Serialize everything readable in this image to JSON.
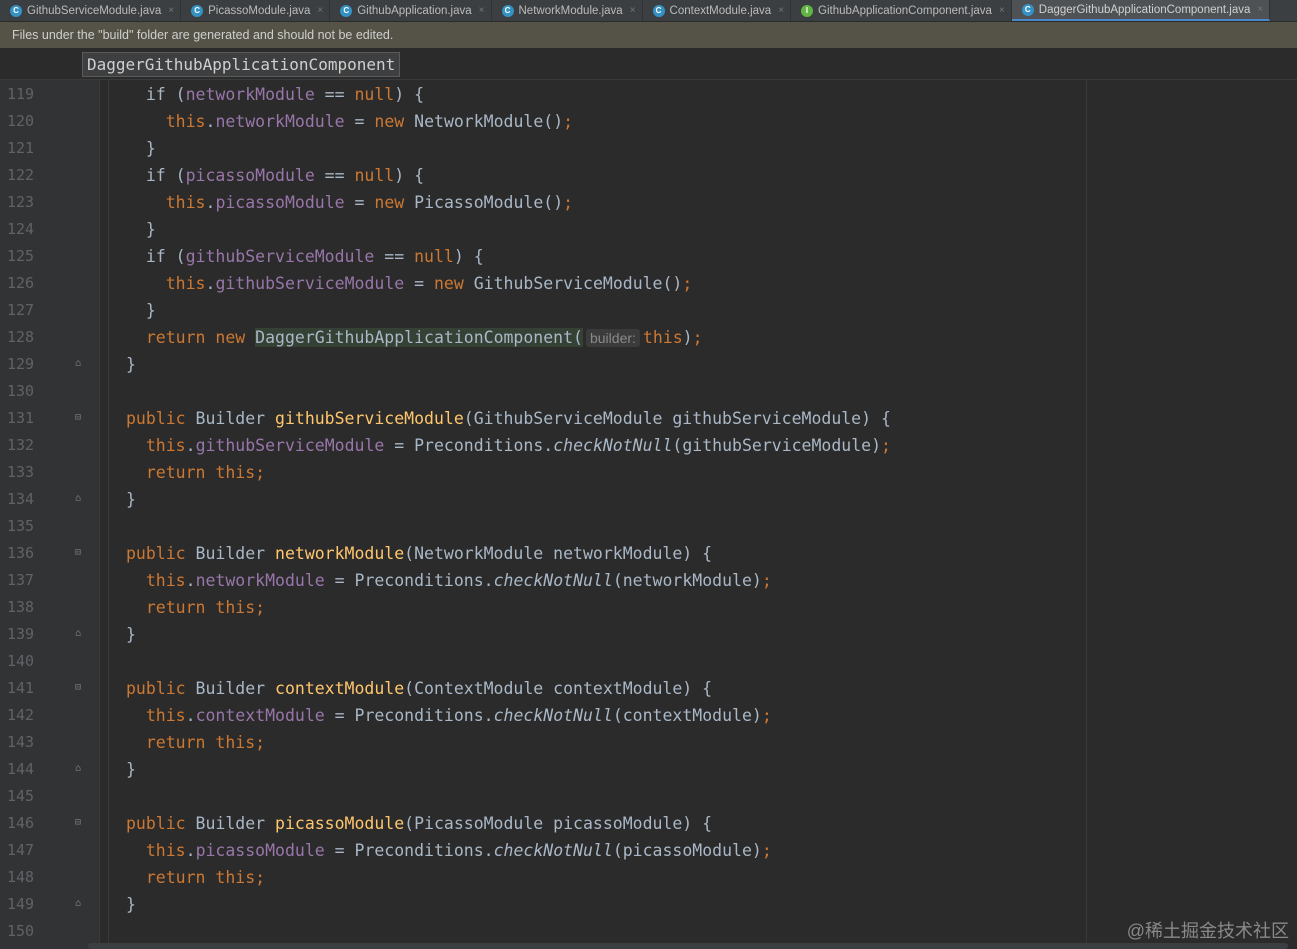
{
  "tabs": [
    {
      "label": "GithubServiceModule.java",
      "icon": "C",
      "color": "blue"
    },
    {
      "label": "PicassoModule.java",
      "icon": "C",
      "color": "blue"
    },
    {
      "label": "GithubApplication.java",
      "icon": "C",
      "color": "blue"
    },
    {
      "label": "NetworkModule.java",
      "icon": "C",
      "color": "blue"
    },
    {
      "label": "ContextModule.java",
      "icon": "C",
      "color": "blue"
    },
    {
      "label": "GithubApplicationComponent.java",
      "icon": "I",
      "color": "green"
    },
    {
      "label": "DaggerGithubApplicationComponent.java",
      "icon": "C",
      "color": "blue",
      "active": true
    }
  ],
  "banner": "Files under the \"build\" folder are generated and should not be edited.",
  "breadcrumb": "DaggerGithubApplicationComponent",
  "watermark": "@稀土掘金技术社区",
  "lines": [
    {
      "n": "119",
      "fold": "",
      "html": "  if (<span class='fld'>networkModule</span> == <span class='kw'>null</span>) {"
    },
    {
      "n": "120",
      "fold": "",
      "html": "    <span class='kw'>this</span>.<span class='fld'>networkModule</span> = <span class='kw'>new</span> NetworkModule()<span class='kw'>;</span>"
    },
    {
      "n": "121",
      "fold": "",
      "html": "  }"
    },
    {
      "n": "122",
      "fold": "",
      "html": "  if (<span class='fld'>picassoModule</span> == <span class='kw'>null</span>) {"
    },
    {
      "n": "123",
      "fold": "",
      "html": "    <span class='kw'>this</span>.<span class='fld'>picassoModule</span> = <span class='kw'>new</span> PicassoModule()<span class='kw'>;</span>"
    },
    {
      "n": "124",
      "fold": "",
      "html": "  }"
    },
    {
      "n": "125",
      "fold": "",
      "html": "  if (<span class='fld'>githubServiceModule</span> == <span class='kw'>null</span>) {"
    },
    {
      "n": "126",
      "fold": "",
      "html": "    <span class='kw'>this</span>.<span class='fld'>githubServiceModule</span> = <span class='kw'>new</span> GithubServiceModule()<span class='kw'>;</span>"
    },
    {
      "n": "127",
      "fold": "",
      "html": "  }"
    },
    {
      "n": "128",
      "fold": "",
      "html": "  <span class='kw'>return new</span> <span class='hl'>DaggerGithubApplicationComponent(</span><span class='hint'>builder:</span><span class='kw'>this</span>)<span class='kw'>;</span>"
    },
    {
      "n": "129",
      "fold": "end",
      "html": "}"
    },
    {
      "n": "130",
      "fold": "",
      "html": ""
    },
    {
      "n": "131",
      "fold": "start",
      "html": "<span class='kw'>public</span> Builder <span class='fn'>githubServiceModule</span>(GithubServiceModule githubServiceModule) {"
    },
    {
      "n": "132",
      "fold": "",
      "html": "  <span class='kw'>this</span>.<span class='fld'>githubServiceModule</span> = Preconditions.<span class='ital'>checkNotNull</span>(githubServiceModule)<span class='kw'>;</span>"
    },
    {
      "n": "133",
      "fold": "",
      "html": "  <span class='kw'>return this;</span>"
    },
    {
      "n": "134",
      "fold": "end",
      "html": "}"
    },
    {
      "n": "135",
      "fold": "",
      "html": ""
    },
    {
      "n": "136",
      "fold": "start",
      "html": "<span class='kw'>public</span> Builder <span class='fn'>networkModule</span>(NetworkModule networkModule) {"
    },
    {
      "n": "137",
      "fold": "",
      "html": "  <span class='kw'>this</span>.<span class='fld'>networkModule</span> = Preconditions.<span class='ital'>checkNotNull</span>(networkModule)<span class='kw'>;</span>"
    },
    {
      "n": "138",
      "fold": "",
      "html": "  <span class='kw'>return this;</span>"
    },
    {
      "n": "139",
      "fold": "end",
      "html": "}"
    },
    {
      "n": "140",
      "fold": "",
      "html": ""
    },
    {
      "n": "141",
      "fold": "start",
      "html": "<span class='kw'>public</span> Builder <span class='fn'>contextModule</span>(ContextModule contextModule) {"
    },
    {
      "n": "142",
      "fold": "",
      "html": "  <span class='kw'>this</span>.<span class='fld'>contextModule</span> = Preconditions.<span class='ital'>checkNotNull</span>(contextModule)<span class='kw'>;</span>"
    },
    {
      "n": "143",
      "fold": "",
      "html": "  <span class='kw'>return this;</span>"
    },
    {
      "n": "144",
      "fold": "end",
      "html": "}"
    },
    {
      "n": "145",
      "fold": "",
      "html": ""
    },
    {
      "n": "146",
      "fold": "start",
      "html": "<span class='kw'>public</span> Builder <span class='fn'>picassoModule</span>(PicassoModule picassoModule) {"
    },
    {
      "n": "147",
      "fold": "",
      "html": "  <span class='kw'>this</span>.<span class='fld'>picassoModule</span> = Preconditions.<span class='ital'>checkNotNull</span>(picassoModule)<span class='kw'>;</span>"
    },
    {
      "n": "148",
      "fold": "",
      "html": "  <span class='kw'>return this;</span>"
    },
    {
      "n": "149",
      "fold": "end",
      "html": "}"
    },
    {
      "n": "150",
      "fold": "",
      "html": ""
    }
  ]
}
